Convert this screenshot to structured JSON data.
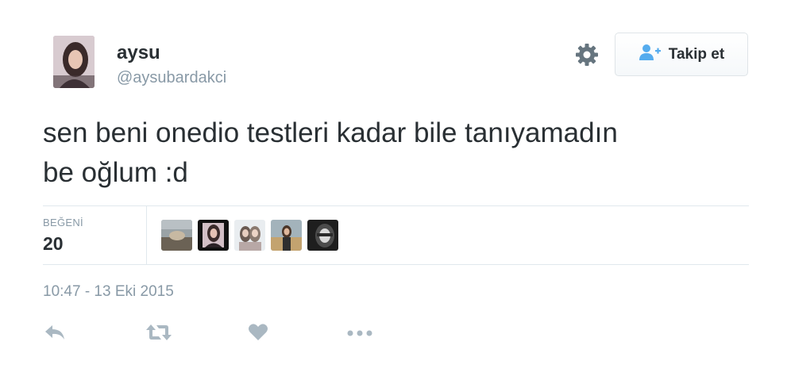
{
  "user": {
    "display_name": "aysu",
    "handle": "@aysubardakci",
    "avatar_icon": "profile-photo"
  },
  "follow_button": {
    "label": "Takip et",
    "icon": "follow-user-plus-icon"
  },
  "settings_icon": "gear-icon",
  "tweet": {
    "text_line1": "sen beni onedio testleri kadar bile tanıyamadın",
    "text_line2": "be oğlum :d",
    "timestamp": "10:47 - 13 Eki 2015"
  },
  "stats": {
    "likes_label": "BEĞENİ",
    "likes_count": "20",
    "liker_avatar_count": 5
  },
  "actions": [
    "reply-icon",
    "retweet-icon",
    "like-heart-icon",
    "more-dots-icon"
  ],
  "colors": {
    "text_primary": "#292f33",
    "text_secondary": "#8899a6",
    "divider": "#e1e8ed",
    "follow_icon": "#55acee",
    "action_icon": "#aab8c2",
    "gear": "#66757f"
  }
}
